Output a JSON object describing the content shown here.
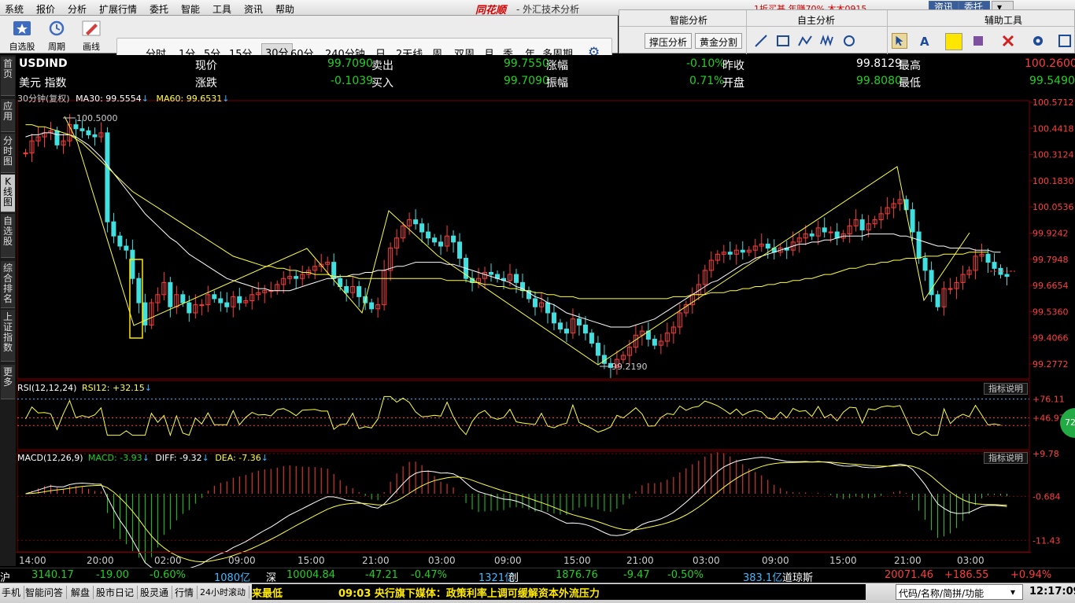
{
  "menu": [
    "系统",
    "报价",
    "分析",
    "扩展行情",
    "委托",
    "智能",
    "工具",
    "资讯",
    "帮助"
  ],
  "brand": {
    "logo": "同花顺",
    "sub": "- 外汇技术分析",
    "promo": "1折买基  年赚70%  木木0915",
    "btn_info": "资讯",
    "btn_trade": "委托"
  },
  "tools": [
    {
      "label": "自选股",
      "icon": "star-icon"
    },
    {
      "label": "周期",
      "icon": "cycle-icon"
    },
    {
      "label": "画线",
      "icon": "pencil-icon"
    }
  ],
  "periods": [
    "分时",
    "1分",
    "5分",
    "15分",
    "30分",
    "60分",
    "240分钟",
    "日",
    "2天线",
    "周",
    "双周",
    "月",
    "季",
    "年",
    "多周期"
  ],
  "selected_period": "30分",
  "right_panel": {
    "headers": [
      "智能分析",
      "自主分析",
      "辅助工具"
    ],
    "buttons": [
      "撑压分析",
      "黄金分割"
    ]
  },
  "left_nav": [
    {
      "label": "首页",
      "active": false
    },
    {
      "label": "应用",
      "active": false
    },
    {
      "label": "分时图",
      "active": false
    },
    {
      "label": "K线图",
      "active": true
    },
    {
      "label": "自选股",
      "active": false
    },
    {
      "label": "综合排名",
      "active": false
    },
    {
      "label": "上证指数",
      "active": false
    },
    {
      "label": "更多",
      "active": false
    }
  ],
  "quote": {
    "code": "USDIND",
    "name": "美元 指数",
    "f1": "现价",
    "v1": "99.7090",
    "f2": "卖出",
    "v2": "99.7550",
    "f3": "涨幅",
    "v3": "-0.10%",
    "f4": "昨收",
    "v4": "99.8129",
    "f5": "最高",
    "v5": "100.2600",
    "g1": "涨跌",
    "w1": "-0.1039",
    "g2": "买入",
    "w2": "99.7090",
    "g3": "振幅",
    "w3": "0.71%",
    "g4": "开盘",
    "w4": "99.8080",
    "g5": "最低",
    "w5": "99.5490"
  },
  "ma_header": {
    "period": "30分钟(复权)",
    "ma30": "MA30: 99.5554",
    "ma60": "MA60: 99.6531"
  },
  "rsi_header": {
    "name": "RSI(12,12,24)",
    "rsi12": "RSI12: +32.15"
  },
  "macd_header": {
    "name": "MACD(12,26,9)",
    "macd": "MACD: -3.93",
    "diff": "DIFF: -9.32",
    "dea": "DEA: -7.36"
  },
  "indicator_btn": "指标说明",
  "circle_badge": "72",
  "chart_data": {
    "type": "candlestick",
    "price_ticks": [
      "100.5712",
      "100.4418",
      "100.3124",
      "100.1830",
      "100.0536",
      "99.9242",
      "99.7948",
      "99.6654",
      "99.5360",
      "99.4066",
      "99.2772"
    ],
    "price_range": [
      99.219,
      100.5712
    ],
    "high_label": "100.5000",
    "low_label": "99.2190",
    "rsi_ticks": [
      "+76.11",
      "+46.97"
    ],
    "macd_ticks": [
      "+9.78",
      "-0.684",
      "-11.43"
    ],
    "time_ticks": [
      "14:00",
      "20:00",
      "02:00",
      "09:00",
      "15:00",
      "21:00",
      "03:00",
      "09:00",
      "15:00",
      "21:00",
      "03:00",
      "09:00",
      "15:00",
      "21:00",
      "03:00"
    ],
    "closes": [
      100.32,
      100.38,
      100.4,
      100.42,
      100.43,
      100.36,
      100.38,
      100.46,
      100.44,
      100.43,
      100.41,
      100.4,
      100.42,
      99.98,
      99.91,
      99.86,
      99.84,
      99.7,
      99.58,
      99.47,
      99.58,
      99.62,
      99.68,
      99.56,
      99.62,
      99.58,
      99.53,
      99.57,
      99.57,
      99.62,
      99.6,
      99.58,
      99.56,
      99.61,
      99.58,
      99.59,
      99.62,
      99.63,
      99.64,
      99.64,
      99.67,
      99.7,
      99.71,
      99.7,
      99.72,
      99.74,
      99.76,
      99.77,
      99.78,
      99.7,
      99.66,
      99.63,
      99.66,
      99.61,
      99.58,
      99.55,
      99.57,
      99.74,
      99.85,
      99.9,
      99.96,
      99.99,
      99.97,
      99.93,
      99.9,
      99.88,
      99.86,
      99.91,
      99.88,
      99.8,
      99.7,
      99.68,
      99.7,
      99.73,
      99.72,
      99.7,
      99.69,
      99.72,
      99.68,
      99.64,
      99.6,
      99.56,
      99.58,
      99.53,
      99.48,
      99.45,
      99.43,
      99.5,
      99.47,
      99.43,
      99.38,
      99.32,
      99.28,
      99.26,
      99.3,
      99.32,
      99.36,
      99.42,
      99.44,
      99.4,
      99.37,
      99.39,
      99.43,
      99.46,
      99.53,
      99.57,
      99.62,
      99.67,
      99.74,
      99.79,
      99.82,
      99.83,
      99.82,
      99.84,
      99.83,
      99.84,
      99.86,
      99.87,
      99.85,
      99.83,
      99.85,
      99.84,
      99.88,
      99.9,
      99.92,
      99.91,
      99.95,
      99.93,
      99.93,
      99.9,
      99.92,
      99.96,
      99.99,
      99.94,
      99.97,
      99.99,
      100.02,
      100.05,
      100.07,
      100.09,
      100.04,
      99.93,
      99.8,
      99.74,
      99.62,
      99.56,
      99.65,
      99.65,
      99.68,
      99.72,
      99.74,
      99.81,
      99.82,
      99.78,
      99.75,
      99.72,
      99.71
    ],
    "ma30": [
      100.4,
      100.41,
      100.41,
      100.42,
      100.42,
      100.41,
      100.41,
      100.41,
      100.4,
      100.38,
      100.36,
      100.33,
      100.3,
      100.26,
      100.22,
      100.18,
      100.14,
      100.1,
      100.06,
      100.02,
      99.99,
      99.96,
      99.93,
      99.9,
      99.88,
      99.85,
      99.82,
      99.8,
      99.78,
      99.76,
      99.74,
      99.72,
      99.7,
      99.69,
      99.68,
      99.67,
      99.66,
      99.65,
      99.65,
      99.64,
      99.64,
      99.64,
      99.64,
      99.65,
      99.66,
      99.67,
      99.68,
      99.69,
      99.7,
      99.7,
      99.71,
      99.71,
      99.72,
      99.72,
      99.73,
      99.73,
      99.74,
      99.74,
      99.75,
      99.76,
      99.76,
      99.77,
      99.78,
      99.78,
      99.78,
      99.78,
      99.78,
      99.77,
      99.77,
      99.76,
      99.75,
      99.74,
      99.73,
      99.72,
      99.71,
      99.7,
      99.69,
      99.68,
      99.66,
      99.65,
      99.63,
      99.61,
      99.6,
      99.58,
      99.57,
      99.55,
      99.53,
      99.52,
      99.51,
      99.5,
      99.49,
      99.48,
      99.47,
      99.46,
      99.46,
      99.46,
      99.46,
      99.47,
      99.48,
      99.49,
      99.5,
      99.52,
      99.54,
      99.56,
      99.58,
      99.6,
      99.62,
      99.64,
      99.66,
      99.68,
      99.69,
      99.71,
      99.73,
      99.75,
      99.77,
      99.78,
      99.8,
      99.81,
      99.82,
      99.83,
      99.84,
      99.85,
      99.86,
      99.87,
      99.87,
      99.88,
      99.88,
      99.89,
      99.89,
      99.9,
      99.91,
      99.91,
      99.91,
      99.91,
      99.92,
      99.92,
      99.92,
      99.92,
      99.92,
      99.91,
      99.91,
      99.9,
      99.89,
      99.88,
      99.87,
      99.86,
      99.86,
      99.85,
      99.85,
      99.85,
      99.85,
      99.84,
      99.84,
      99.84,
      99.83,
      99.83
    ],
    "ma60": [
      100.46,
      100.46,
      100.45,
      100.45,
      100.44,
      100.43,
      100.42,
      100.41,
      100.39,
      100.37,
      100.34,
      100.31,
      100.28,
      100.25,
      100.22,
      100.19,
      100.16,
      100.13,
      100.11,
      100.09,
      100.07,
      100.05,
      100.03,
      100.01,
      99.99,
      99.97,
      99.95,
      99.93,
      99.91,
      99.89,
      99.87,
      99.85,
      99.83,
      99.81,
      99.8,
      99.79,
      99.78,
      99.77,
      99.76,
      99.76,
      99.75,
      99.75,
      99.74,
      99.74,
      99.73,
      99.73,
      99.72,
      99.72,
      99.72,
      99.71,
      99.71,
      99.71,
      99.71,
      99.7,
      99.7,
      99.7,
      99.7,
      99.7,
      99.7,
      99.7,
      99.7,
      99.7,
      99.7,
      99.7,
      99.7,
      99.7,
      99.7,
      99.69,
      99.69,
      99.69,
      99.69,
      99.68,
      99.68,
      99.67,
      99.67,
      99.66,
      99.66,
      99.65,
      99.65,
      99.64,
      99.64,
      99.63,
      99.63,
      99.62,
      99.62,
      99.61,
      99.61,
      99.61,
      99.6,
      99.6,
      99.6,
      99.6,
      99.6,
      99.6,
      99.6,
      99.6,
      99.6,
      99.6,
      99.6,
      99.6,
      99.6,
      99.6,
      99.6,
      99.61,
      99.61,
      99.61,
      99.62,
      99.62,
      99.62,
      99.63,
      99.63,
      99.63,
      99.64,
      99.64,
      99.65,
      99.65,
      99.66,
      99.66,
      99.67,
      99.67,
      99.68,
      99.68,
      99.69,
      99.69,
      99.7,
      99.7,
      99.71,
      99.72,
      99.72,
      99.73,
      99.74,
      99.75,
      99.75,
      99.76,
      99.77,
      99.77,
      99.78,
      99.78,
      99.79,
      99.79,
      99.8,
      99.8,
      99.8,
      99.81,
      99.81,
      99.81,
      99.82,
      99.82,
      99.82,
      99.82,
      99.83,
      99.83,
      99.83,
      99.83
    ]
  },
  "ticker": [
    {
      "t": "沪",
      "c": "#fff"
    },
    {
      "t": "3140.17",
      "c": "#20d020"
    },
    {
      "t": "-19.00",
      "c": "#20d020"
    },
    {
      "t": "-0.60%",
      "c": "#20d020"
    },
    {
      "t": "1080亿",
      "c": "#40b8ff"
    },
    {
      "t": "深",
      "c": "#fff"
    },
    {
      "t": "10004.84",
      "c": "#20d020"
    },
    {
      "t": "-47.21",
      "c": "#20d020"
    },
    {
      "t": "-0.47%",
      "c": "#20d020"
    },
    {
      "t": "1321亿",
      "c": "#40b8ff"
    },
    {
      "t": "创",
      "c": "#fff"
    },
    {
      "t": "1876.76",
      "c": "#20d020"
    },
    {
      "t": "-9.47",
      "c": "#20d020"
    },
    {
      "t": "-0.50%",
      "c": "#20d020"
    },
    {
      "t": "383.1亿",
      "c": "#40b8ff"
    },
    {
      "t": "道琼斯",
      "c": "#fff"
    },
    {
      "t": "20071.46",
      "c": "#ff3c3c"
    },
    {
      "t": "+186.55",
      "c": "#ff3c3c"
    },
    {
      "t": "+0.94%",
      "c": "#ff3c3c"
    }
  ],
  "status": {
    "items": [
      "手机",
      "智能问答",
      "解盘",
      "股市日记",
      "股灵通",
      "行情",
      "24小时滚动"
    ],
    "alert": "来最低",
    "news": "09:03 央行旗下媒体：政策利率上调可缓解资本外流压力",
    "search": "代码/名称/简拼/功能",
    "clock": "12:17:09"
  },
  "colors": {
    "up": "#ff3c3c",
    "down": "#40e0e0",
    "ma30": "#ffffff",
    "ma60": "#ffff40",
    "axis": "#7a0000",
    "bg": "#000000"
  }
}
